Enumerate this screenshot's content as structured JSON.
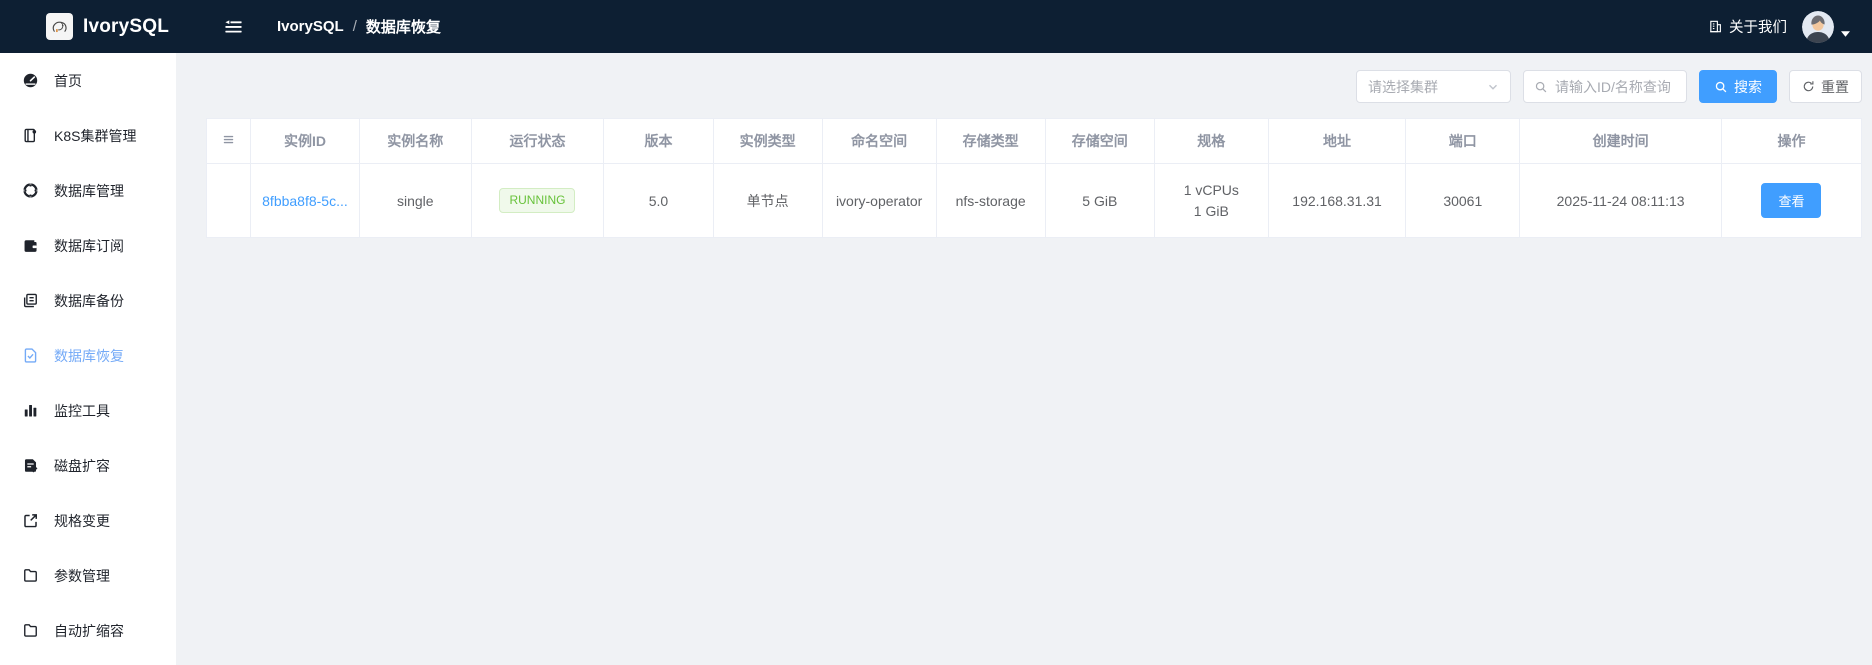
{
  "navbar": {
    "brand": "IvorySQL",
    "breadcrumb": {
      "root": "IvorySQL",
      "separator": "/",
      "current": "数据库恢复"
    },
    "about_label": "关于我们"
  },
  "sidebar": {
    "items": [
      {
        "label": "首页",
        "icon": "dashboard-icon",
        "active": false
      },
      {
        "label": "K8S集群管理",
        "icon": "cluster-icon",
        "active": false
      },
      {
        "label": "数据库管理",
        "icon": "database-manage-icon",
        "active": false
      },
      {
        "label": "数据库订阅",
        "icon": "subscription-icon",
        "active": false
      },
      {
        "label": "数据库备份",
        "icon": "backup-copy-icon",
        "active": false
      },
      {
        "label": "数据库恢复",
        "icon": "restore-file-icon",
        "active": true
      },
      {
        "label": "监控工具",
        "icon": "monitor-bars-icon",
        "active": false
      },
      {
        "label": "磁盘扩容",
        "icon": "disk-expand-icon",
        "active": false
      },
      {
        "label": "规格变更",
        "icon": "spec-change-icon",
        "active": false
      },
      {
        "label": "参数管理",
        "icon": "folder-icon",
        "active": false
      },
      {
        "label": "自动扩缩容",
        "icon": "folder-icon",
        "active": false
      }
    ]
  },
  "filters": {
    "cluster_select_placeholder": "请选择集群",
    "search_placeholder": "请输入ID/名称查询",
    "search_button": "搜索",
    "reset_button": "重置"
  },
  "table": {
    "headers": [
      "实例ID",
      "实例名称",
      "运行状态",
      "版本",
      "实例类型",
      "命名空间",
      "存储类型",
      "存储空间",
      "规格",
      "地址",
      "端口",
      "创建时间",
      "操作"
    ],
    "rows": [
      {
        "instance_id": "8fbba8f8-5c...",
        "name": "single",
        "status": "RUNNING",
        "version": "5.0",
        "type": "单节点",
        "namespace": "ivory-operator",
        "storage_type": "nfs-storage",
        "storage_size": "5 GiB",
        "spec_line1": "1 vCPUs",
        "spec_line2": "1 GiB",
        "address": "192.168.31.31",
        "port": "30061",
        "created_at": "2025-11-24 08:11:13",
        "action": "查看"
      }
    ]
  },
  "colors": {
    "navbar_bg": "#0d1f33",
    "accent_blue": "#409eff",
    "sidebar_active": "#74aaf7",
    "success_green": "#67c23a",
    "page_bg": "#f0f2f5",
    "table_border": "#ebeef5"
  }
}
